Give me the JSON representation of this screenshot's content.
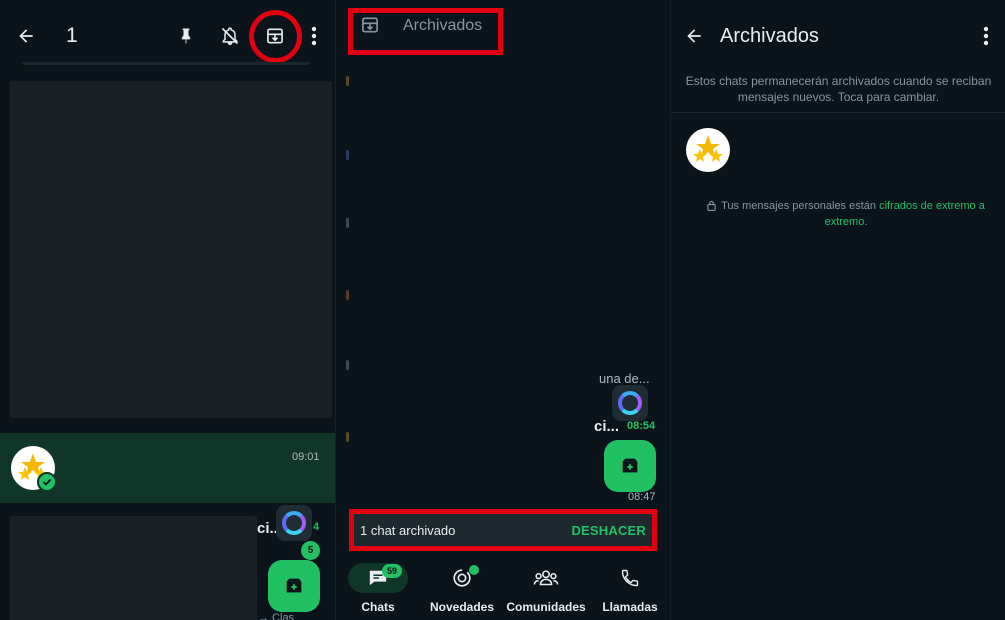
{
  "panel1": {
    "selected_count": "1",
    "chat_row": {
      "time": "09:01"
    },
    "fragment_text": "ci...",
    "unread_time": "4",
    "unread_badge": "5",
    "bottom_fragment": "→ Clas"
  },
  "panel2": {
    "header_title": "Archivados",
    "preview_snippet": "una de...",
    "fragment_text": "ci...",
    "time_1": "08:54",
    "time_2": "08:47",
    "snackbar": {
      "message": "1 chat archivado",
      "action": "DESHACER"
    },
    "nav": [
      {
        "label": "Chats",
        "icon": "chat-icon",
        "badge": "59"
      },
      {
        "label": "Novedades",
        "icon": "status-icon"
      },
      {
        "label": "Comunidades",
        "icon": "communities-icon"
      },
      {
        "label": "Llamadas",
        "icon": "phone-icon"
      }
    ]
  },
  "panel3": {
    "title": "Archivados",
    "info_text": "Estos chats permanecerán archivados cuando se reciban mensajes nuevos. Toca para cambiar.",
    "encryption_prefix": "Tus mensajes personales están ",
    "encryption_link": "cifrados de extremo a extremo",
    "encryption_suffix": "."
  },
  "colors": {
    "background": "#0b141a",
    "accent_green": "#21c063",
    "selected_row": "#103529",
    "highlight_red": "#e0000f"
  }
}
